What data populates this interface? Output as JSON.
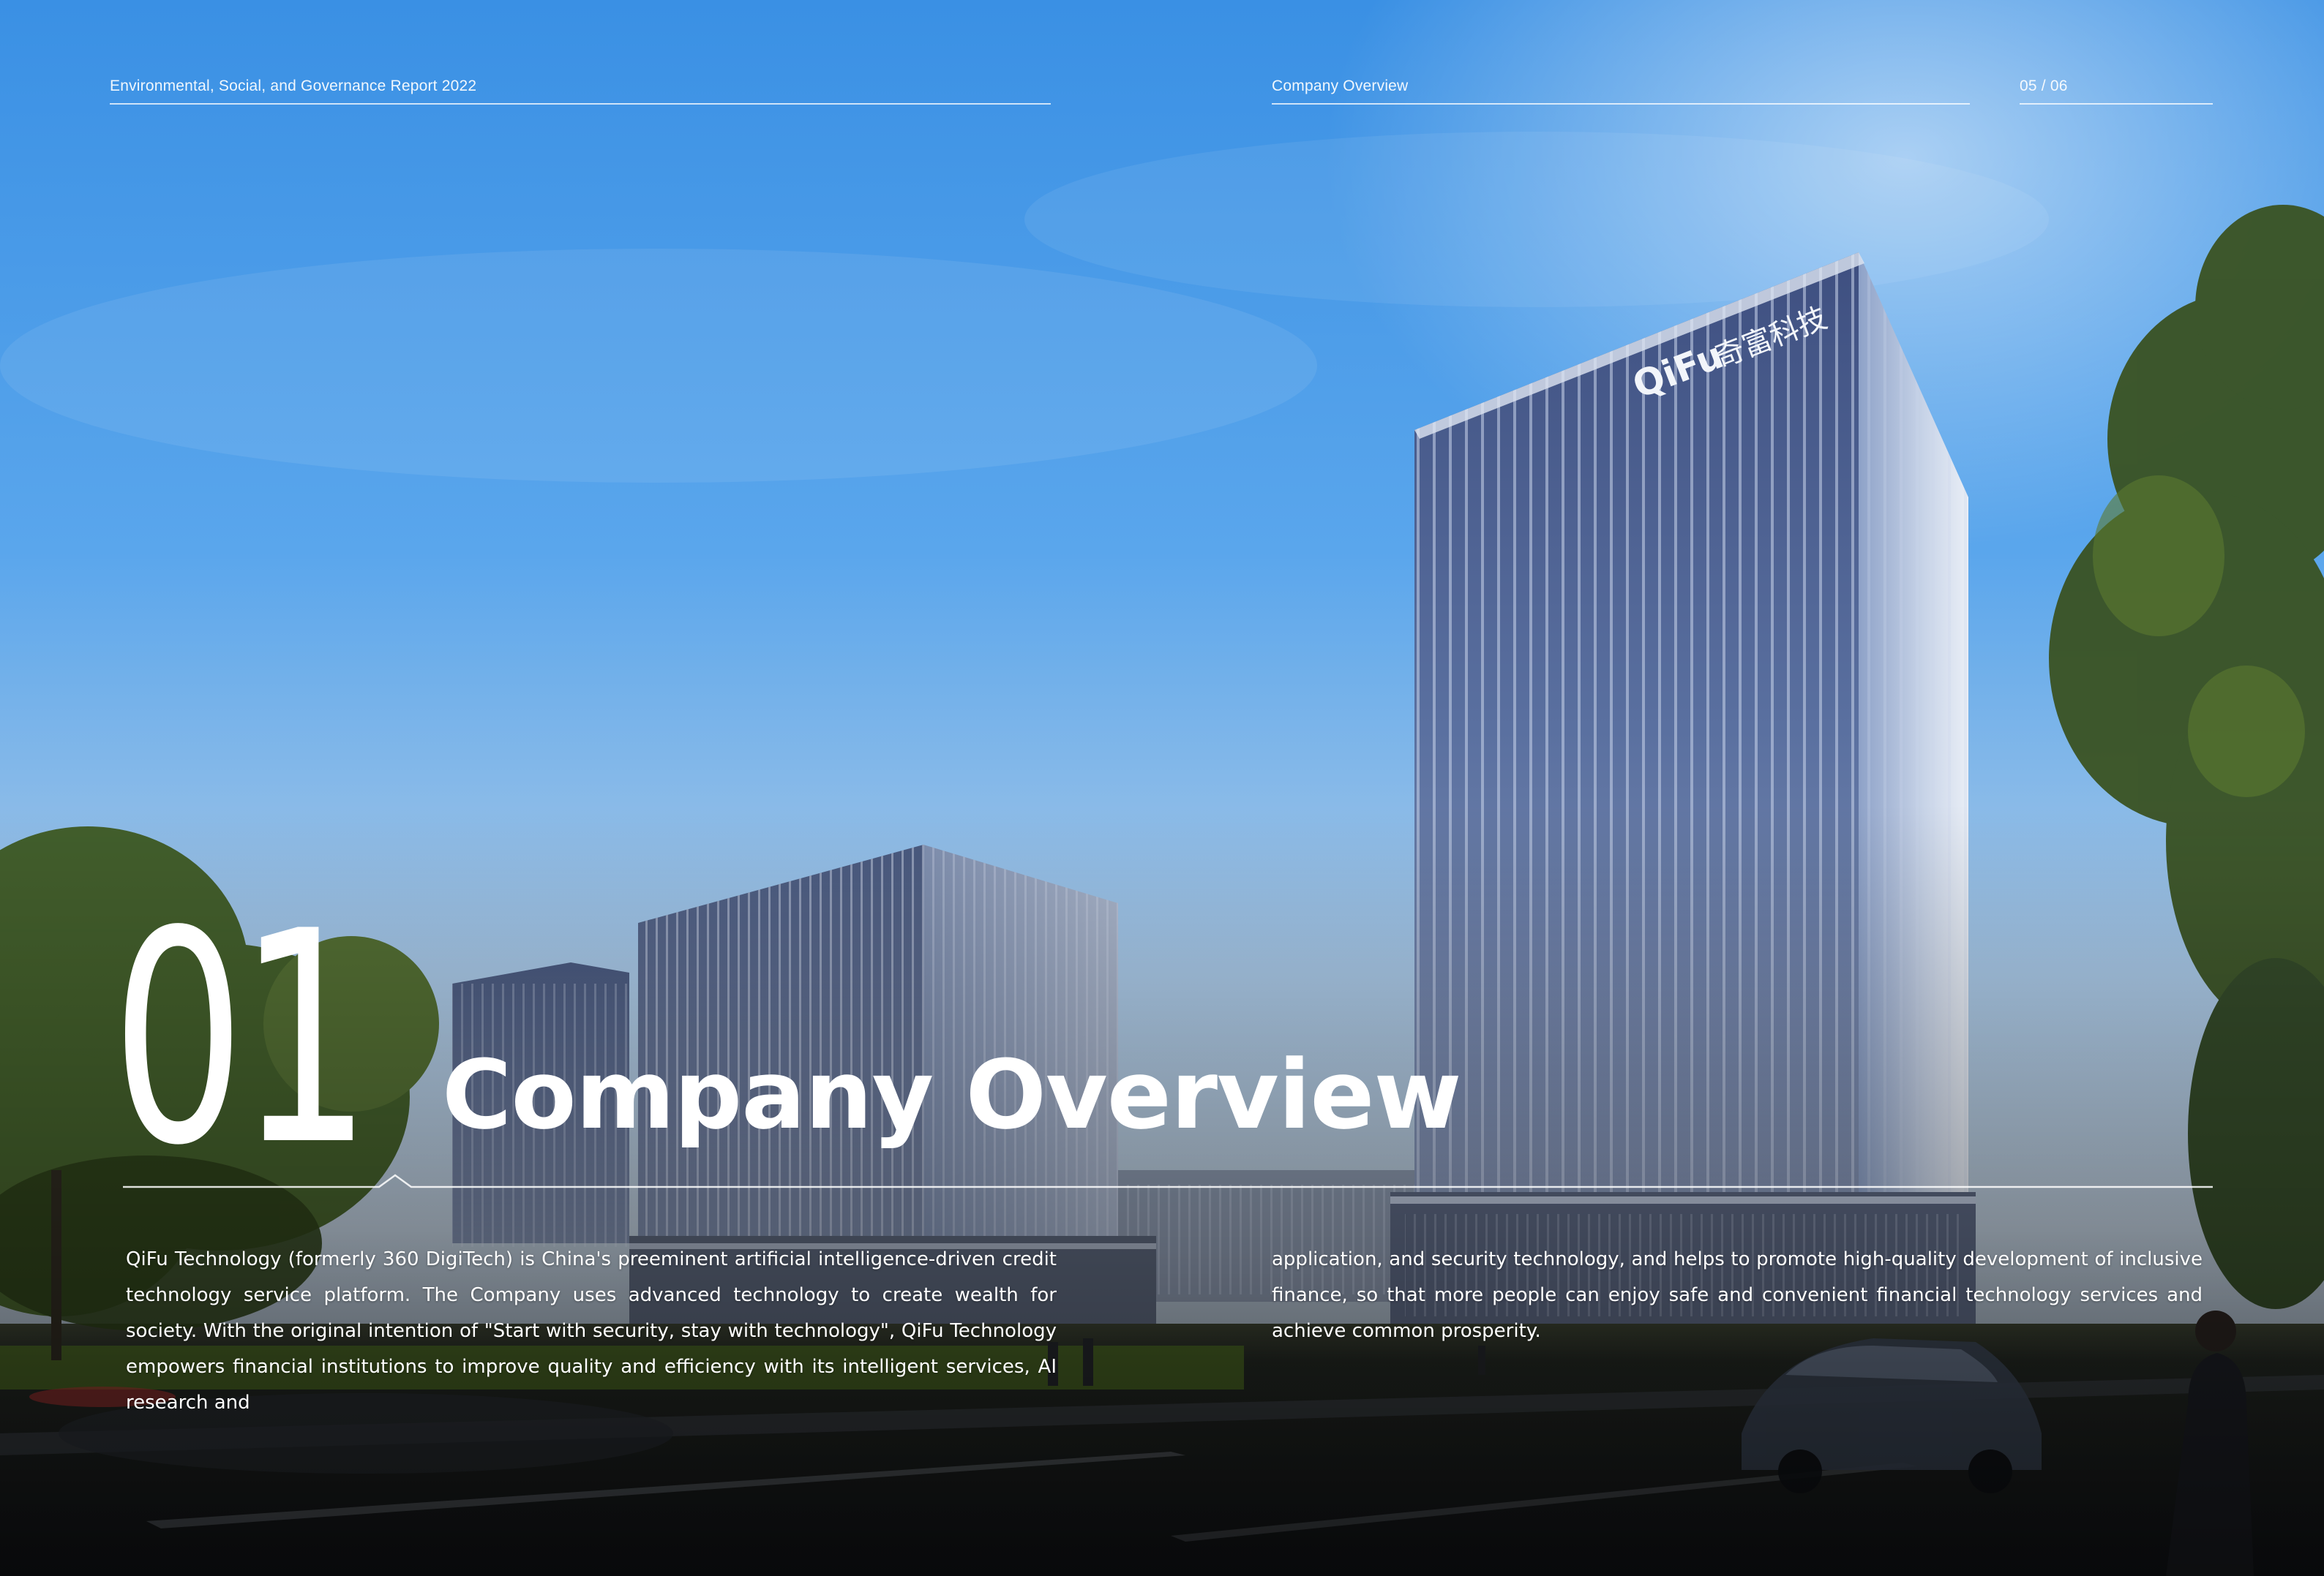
{
  "header": {
    "report_title": "Environmental, Social, and Governance Report 2022",
    "section": "Company Overview",
    "page_indicator": "05 / 06"
  },
  "chapter": {
    "number": "01",
    "title": "Company Overview"
  },
  "building_sign": {
    "logo_text": "QiFu",
    "chinese_text": "奇富科技"
  },
  "body": {
    "column_1": "QiFu Technology (formerly 360 DigiTech) is China's preeminent artificial intelligence-driven credit technology service platform. The Company uses advanced technology to create wealth for society. With the original intention of \"Start with security, stay with technology\", QiFu Technology empowers financial institutions to improve quality and efficiency with its intelligent services, AI research and",
    "column_2": "application, and security technology, and helps to promote high-quality development of inclusive finance, so that more people can enjoy safe and convenient financial technology services and achieve common prosperity."
  },
  "colors": {
    "sky_top": "#3d93e6",
    "sky_mid": "#7fb7ea",
    "haze": "#c9d6e4",
    "glass": "#4a5f8c",
    "foliage": "#3c5424",
    "road": "#17191f",
    "text": "#ffffff"
  }
}
